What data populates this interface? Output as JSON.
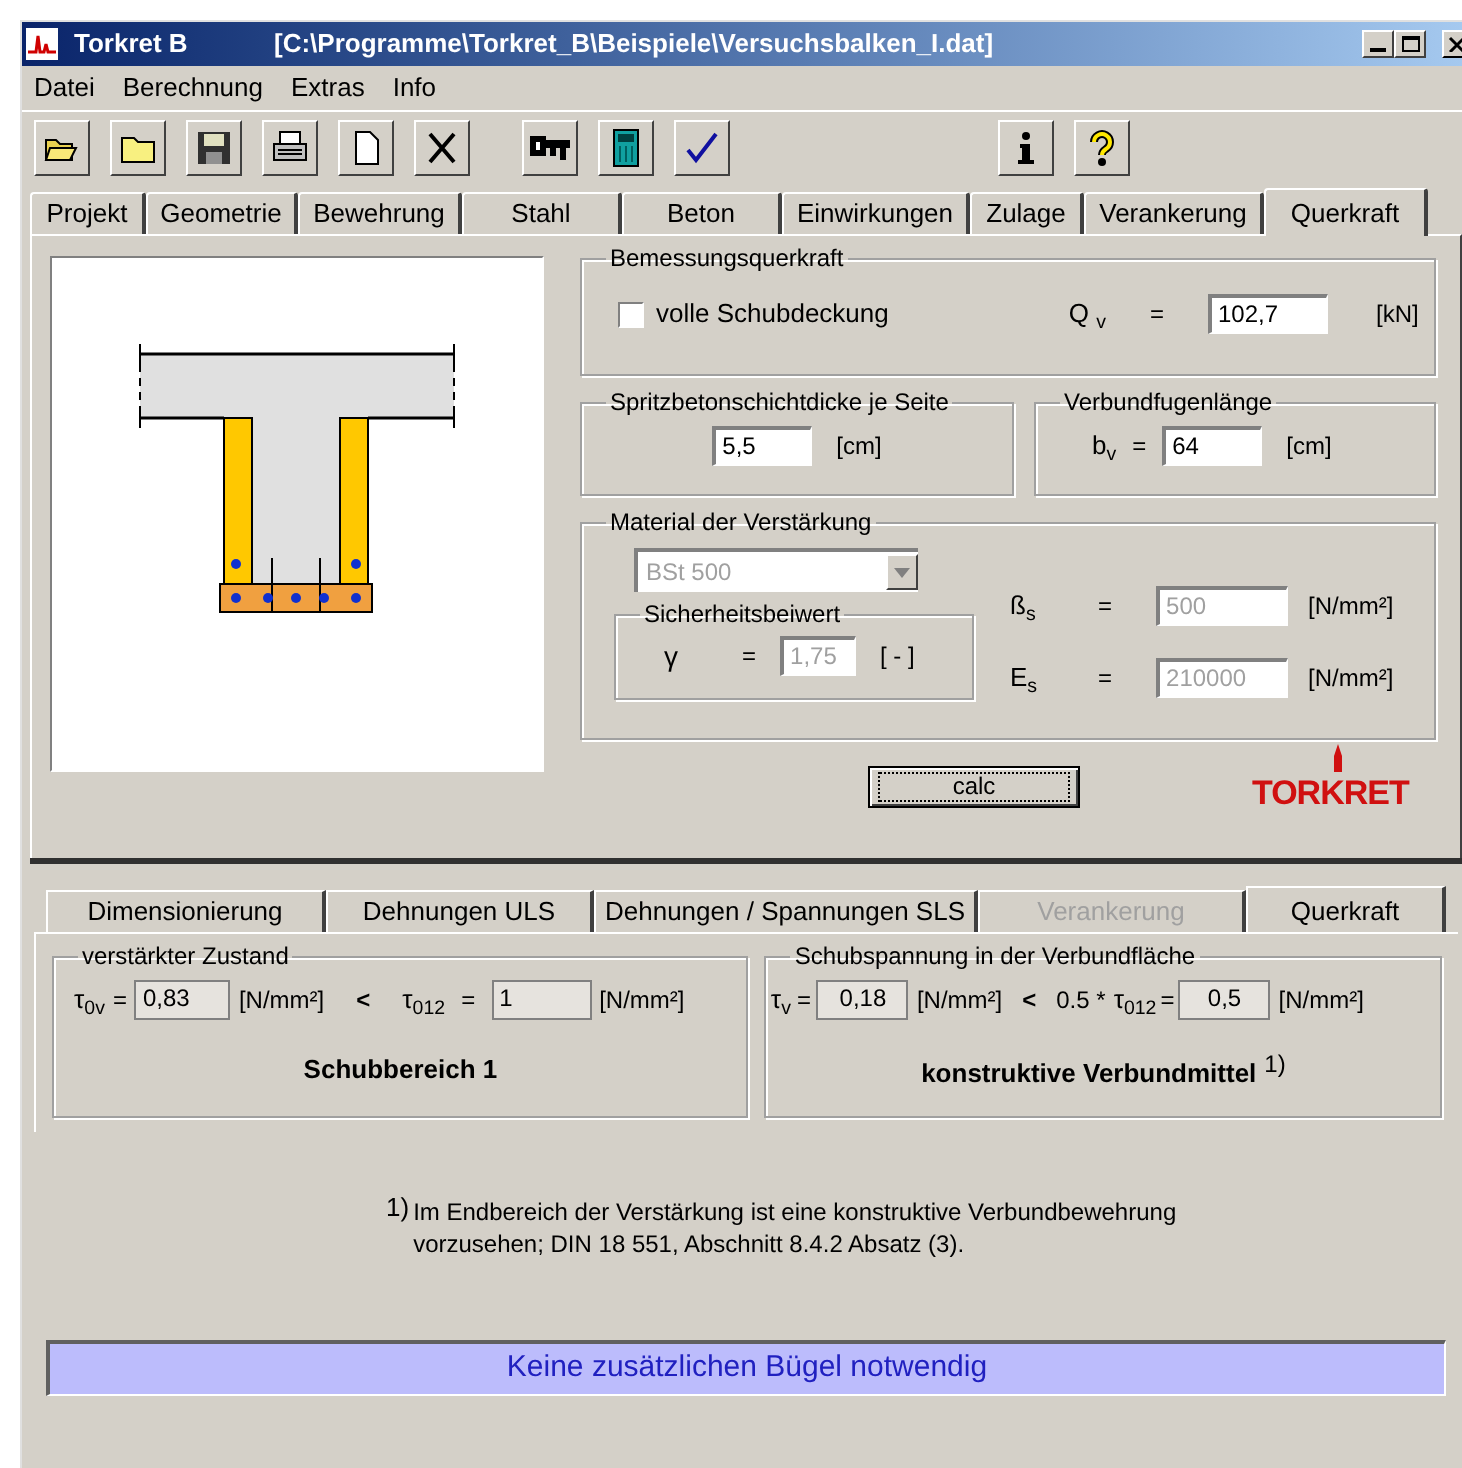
{
  "window": {
    "title": "Torkret B",
    "path": "[C:\\Programme\\Torkret_B\\Beispiele\\Versuchsbalken_I.dat]"
  },
  "menu": [
    "Datei",
    "Berechnung",
    "Extras",
    "Info"
  ],
  "tabs": [
    {
      "label": "Projekt",
      "selected": false
    },
    {
      "label": "Geometrie",
      "selected": false
    },
    {
      "label": "Bewehrung",
      "selected": false
    },
    {
      "label": "Stahl",
      "selected": false
    },
    {
      "label": "Beton",
      "selected": false
    },
    {
      "label": "Einwirkungen",
      "selected": false
    },
    {
      "label": "Zulage",
      "selected": false
    },
    {
      "label": "Verankerung",
      "selected": false
    },
    {
      "label": "Querkraft",
      "selected": true
    }
  ],
  "bemessung": {
    "legend": "Bemessungsquerkraft",
    "checkbox": {
      "label": "volle Schubdeckung",
      "checked": false
    },
    "symbol": "Q $_{v}$",
    "eq": "=",
    "value": "102,7",
    "unit": "[kN]"
  },
  "spritzbeton": {
    "legend": "Spritzbetonschichtdicke je Seite",
    "value": "5,5",
    "unit": "[cm]"
  },
  "verbundfuge": {
    "legend": "Verbundfugenlänge",
    "symbol": "b$_{v}$",
    "eq": "=",
    "value": "64",
    "unit": "[cm]"
  },
  "material": {
    "legend": "Material der Verstärkung",
    "select": {
      "value": "BSt 500",
      "disabled": true
    },
    "safety": {
      "legend": "Sicherheitsbeiwert",
      "symbol": "γ",
      "eq": "=",
      "value": "1,75",
      "unit": "[ - ]",
      "disabled": true
    },
    "beta": {
      "symbol": "ß$_{s}$",
      "eq": "=",
      "value": "500",
      "unit": "[N/mm²]",
      "disabled": true
    },
    "modulus": {
      "symbol": "E$_{s}$",
      "eq": "=",
      "value": "210000",
      "unit": "[N/mm²]",
      "disabled": true
    }
  },
  "calc_button": "calc",
  "logo": "TORKRET",
  "result_tabs": [
    {
      "label": "Dimensionierung",
      "selected": false,
      "disabled": false
    },
    {
      "label": "Dehnungen ULS",
      "selected": false,
      "disabled": false
    },
    {
      "label": "Dehnungen / Spannungen SLS",
      "selected": false,
      "disabled": false
    },
    {
      "label": "Verankerung",
      "selected": false,
      "disabled": true
    },
    {
      "label": "Querkraft",
      "selected": true,
      "disabled": false
    }
  ],
  "zustand": {
    "legend": "verstärkter Zustand",
    "tau0v": {
      "symbol": "τ$_{0v}$",
      "eq": "=",
      "value": "0,83",
      "unit": "[N/mm²]"
    },
    "lt": "<",
    "tau012": {
      "symbol": "τ$_{012}$",
      "eq": "=",
      "value": "1",
      "unit": "[N/mm²]"
    },
    "result": "Schubbereich 1"
  },
  "schub": {
    "legend": "Schubspannung in der Verbundfläche",
    "tauv": {
      "symbol": "τ$_{v}$",
      "eq": "=",
      "value": "0,18",
      "unit": "[N/mm²]"
    },
    "lt": "<",
    "factor": "0.5 *",
    "tau012": {
      "symbol": "τ$_{012}$",
      "eq": "=",
      "value": "0,5",
      "unit": "[N/mm²]"
    },
    "result": "konstruktive Verbundmittel",
    "result_note": "1)"
  },
  "footnote": {
    "mark": "1)",
    "lines": [
      "Im Endbereich der Verstärkung ist eine konstruktive Verbundbewehrung",
      "vorzusehen; DIN 18 551, Abschnitt 8.4.2 Absatz (3)."
    ]
  },
  "status": "Keine zusätzlichen Bügel notwendig"
}
